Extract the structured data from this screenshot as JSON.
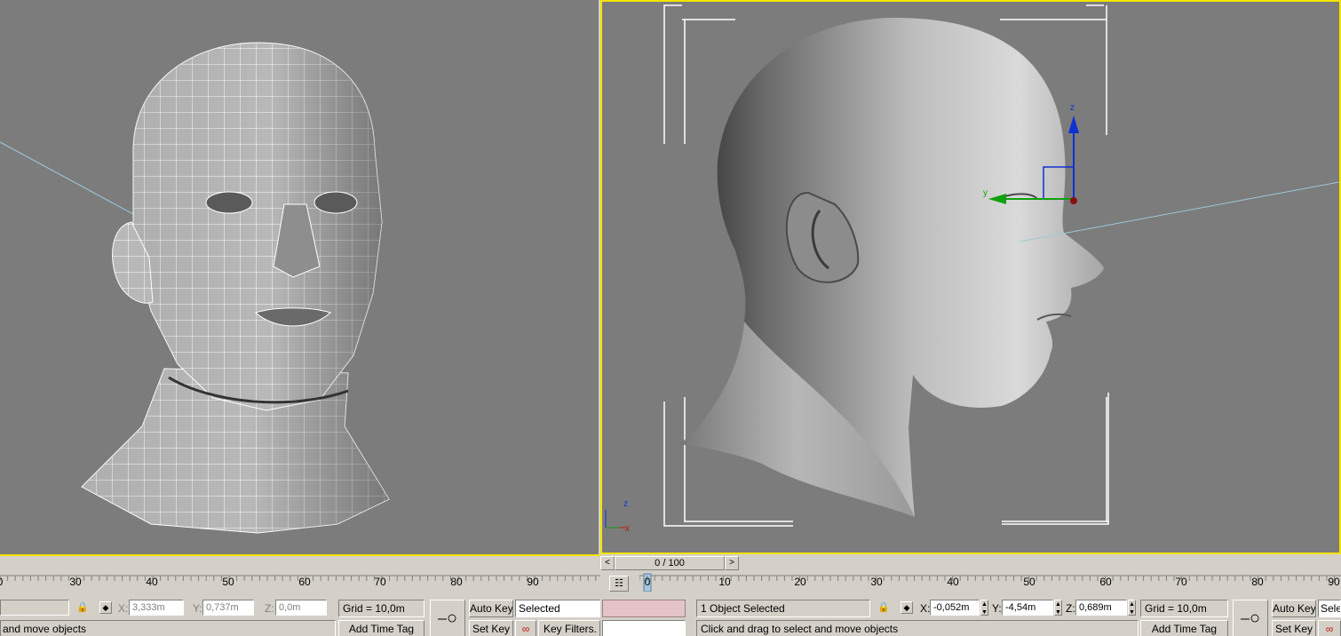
{
  "viewports": {
    "left": {
      "name": "Perspective wireframe view"
    },
    "right": {
      "name": "Shaded side view",
      "gizmo": {
        "x": "",
        "y": "y",
        "z": "z"
      },
      "axis_tripod": {
        "x": "x",
        "z": "z"
      }
    }
  },
  "timeline": {
    "prev_label": "<",
    "next_label": ">",
    "frame_display": "0 / 100",
    "left_ruler_ticks": [
      "0",
      "30",
      "40",
      "50",
      "60",
      "70",
      "80",
      "90"
    ],
    "right_ruler_ticks": [
      "0",
      "10",
      "20",
      "30",
      "40",
      "50",
      "60",
      "70",
      "80",
      "90"
    ],
    "current_frame": "0"
  },
  "status_left": {
    "coords": {
      "x_label": "X:",
      "x_value": "3,333m",
      "y_label": "Y:",
      "y_value": "0,737m",
      "z_label": "Z:",
      "z_value": "0,0m"
    },
    "grid": "Grid = 10,0m",
    "add_time_tag": "Add Time Tag",
    "prompt": "and move objects",
    "auto_key": "Auto Key",
    "set_key": "Set Key",
    "key_mode_value": "Selected",
    "key_filters": "Key Filters."
  },
  "status_right": {
    "selection_info": "1 Object Selected",
    "prompt": "Click and drag to select and move objects",
    "coords": {
      "x_label": "X:",
      "x_value": "-0,052m",
      "y_label": "Y:",
      "y_value": "-4,54m",
      "z_label": "Z:",
      "z_value": "0,689m"
    },
    "grid": "Grid = 10,0m",
    "add_time_tag": "Add Time Tag",
    "auto_key": "Auto Key",
    "set_key": "Set Key",
    "key_mode_value": "Selec"
  },
  "icons": [
    "lock-icon",
    "absolute-mode-icon",
    "key-icon",
    "tangent-icon",
    "timeline-config-icon"
  ],
  "colors": {
    "viewport_bg": "#7c7c7c",
    "active_border": "#f2e300",
    "ui_bg": "#d4d0c8",
    "gizmo_z": "#1030d0",
    "gizmo_y": "#10a010",
    "gizmo_x": "#c01010"
  }
}
